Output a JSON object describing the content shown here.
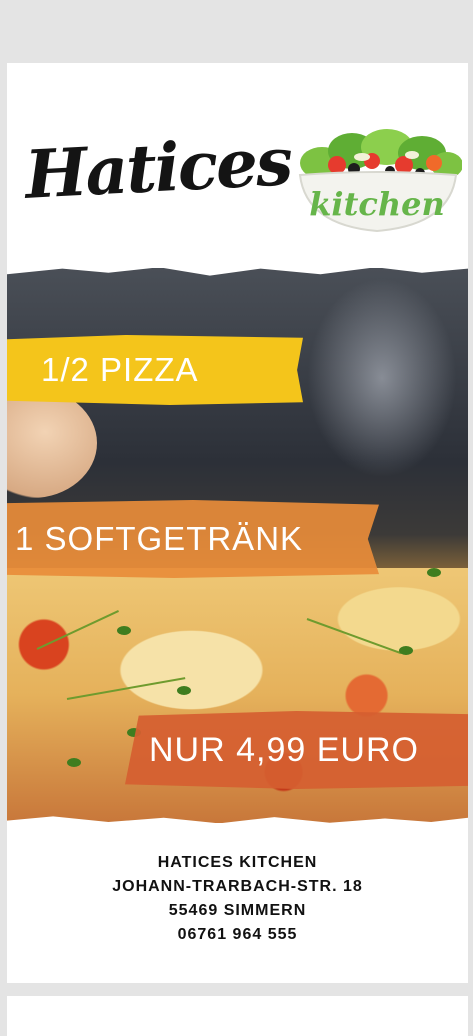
{
  "brand": {
    "name": "Hatices",
    "sub": "kitchen"
  },
  "offer": {
    "line1": "1/2 PIZZA",
    "line2": "1 SOFTGETRÄNK",
    "price": "NUR 4,99 EURO"
  },
  "address": {
    "business": "HATICES KITCHEN",
    "street": "JOHANN-TRARBACH-STR. 18",
    "city": "55469 SIMMERN",
    "phone": "06761 964 555"
  },
  "colors": {
    "yellow_banner": "#f4c51b",
    "orange_banner": "#e88c3a",
    "red_banner": "#d55f30",
    "kitchen_green": "#66b54a"
  },
  "icons": {
    "bowl": "salad-bowl-icon"
  }
}
